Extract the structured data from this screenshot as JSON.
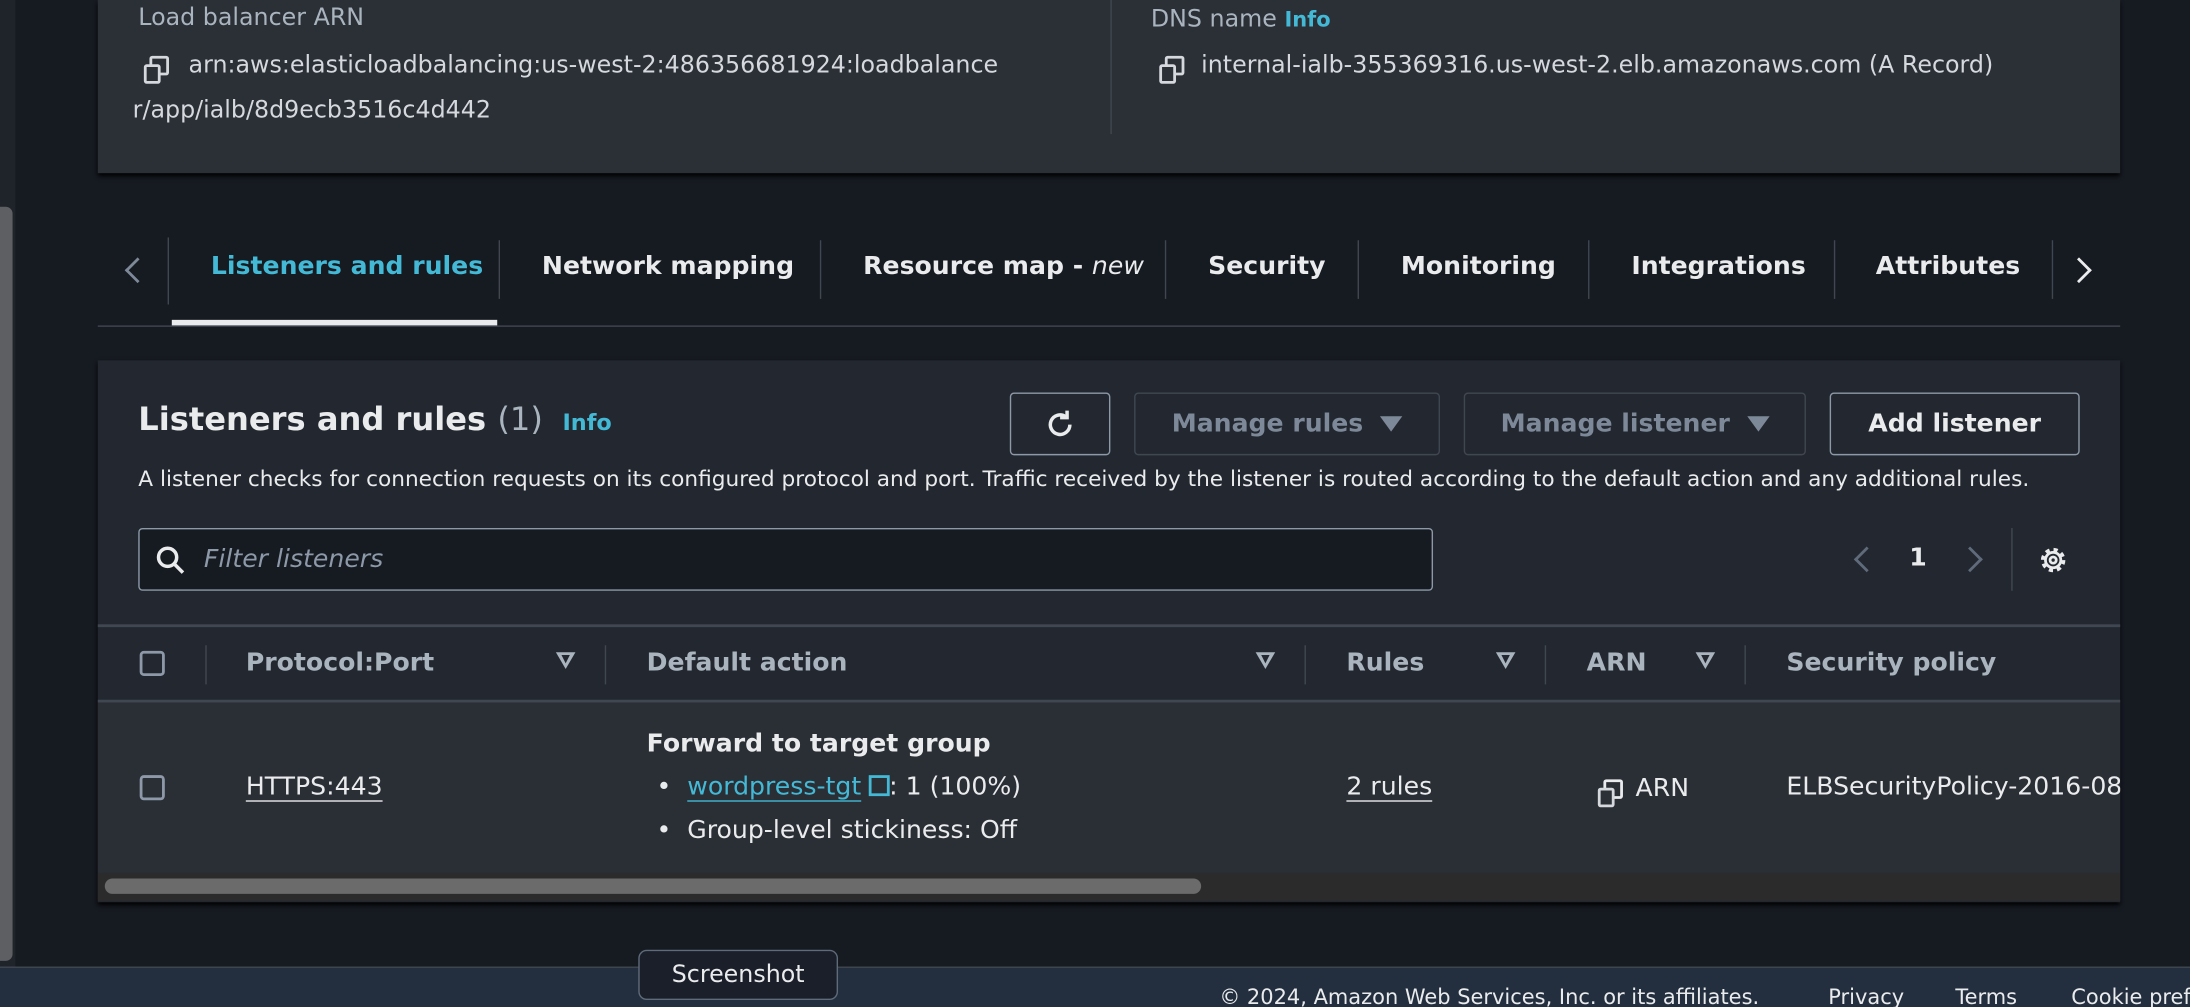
{
  "summary": {
    "arn_label": "Load balancer ARN",
    "arn_line1": "arn:aws:elasticloadbalancing:us-west-2:486356681924:loadbalance",
    "arn_line2": "r/app/ialb/8d9ecb3516c4d442",
    "dns_label": "DNS name",
    "dns_info": "Info",
    "dns_value": "internal-ialb-355369316.us-west-2.elb.amazonaws.com (A Record)"
  },
  "tabs": [
    {
      "label": "Listeners and rules",
      "active": true
    },
    {
      "label": "Network mapping"
    },
    {
      "label": "Resource map - ",
      "suffix": "new"
    },
    {
      "label": "Security"
    },
    {
      "label": "Monitoring"
    },
    {
      "label": "Integrations"
    },
    {
      "label": "Attributes"
    }
  ],
  "listeners": {
    "title": "Listeners and rules",
    "count": "(1)",
    "info": "Info",
    "description": "A listener checks for connection requests on its configured protocol and port. Traffic received by the listener is routed according to the default action and any additional rules.",
    "buttons": {
      "manage_rules": "Manage rules",
      "manage_listener": "Manage listener",
      "add_listener": "Add listener"
    },
    "filter_placeholder": "Filter listeners",
    "page": "1",
    "columns": [
      "Protocol:Port",
      "Default action",
      "Rules",
      "ARN",
      "Security policy"
    ],
    "rows": [
      {
        "protocol_port": "HTTPS:443",
        "action_title": "Forward to target group",
        "target_group": "wordpress-tgt",
        "target_weight": ": 1 (100%)",
        "stickiness": "Group-level stickiness: Off",
        "rules": "2 rules",
        "arn": "ARN",
        "security_policy": "ELBSecurityPolicy-2016-08"
      }
    ]
  },
  "tooltip": "Screenshot",
  "footer": {
    "copyright": "© 2024, Amazon Web Services, Inc. or its affiliates.",
    "links": [
      "Privacy",
      "Terms",
      "Cookie preferences"
    ]
  },
  "colors": {
    "accent": "#44b9d6",
    "footer": "#232f3e",
    "background": "#161a21"
  }
}
